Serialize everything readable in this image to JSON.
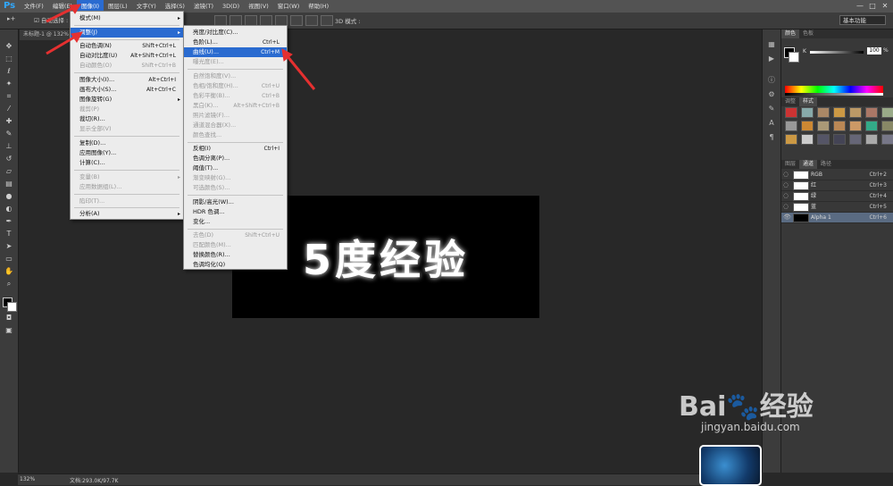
{
  "app": {
    "logo": "Ps",
    "accent_color": "#2a6bd0"
  },
  "menubar": {
    "items": [
      {
        "label": "文件(F)"
      },
      {
        "label": "编辑(E)"
      },
      {
        "label": "图像(I)",
        "active": true
      },
      {
        "label": "图层(L)"
      },
      {
        "label": "文字(Y)"
      },
      {
        "label": "选择(S)"
      },
      {
        "label": "滤镜(T)"
      },
      {
        "label": "3D(D)"
      },
      {
        "label": "视图(V)"
      },
      {
        "label": "窗口(W)"
      },
      {
        "label": "帮助(H)"
      }
    ],
    "window_controls": [
      "—",
      "□",
      "✕"
    ]
  },
  "options": {
    "tool_preset": "▸+",
    "auto_select": "☑ 自动选择 :",
    "mode_3d": "3D 模式 :",
    "workspace": "基本功能"
  },
  "doc_tab": {
    "label": "未标题-1 @ 132%"
  },
  "canvas": {
    "text": "5度经验",
    "background": "#000000"
  },
  "image_menu": {
    "items": [
      {
        "label": "模式(M)",
        "arrow": "▸"
      },
      {
        "label": "调整(J)",
        "arrow": "▸",
        "highlight": true
      },
      {
        "label": "自动色调(N)",
        "shortcut": "Shift+Ctrl+L"
      },
      {
        "label": "自动对比度(U)",
        "shortcut": "Alt+Shift+Ctrl+L"
      },
      {
        "label": "自动颜色(O)",
        "shortcut": "Shift+Ctrl+B",
        "disabled": true
      },
      {
        "label": "图像大小(I)...",
        "shortcut": "Alt+Ctrl+I"
      },
      {
        "label": "画布大小(S)...",
        "shortcut": "Alt+Ctrl+C"
      },
      {
        "label": "图像旋转(G)",
        "arrow": "▸"
      },
      {
        "label": "裁剪(P)",
        "disabled": true
      },
      {
        "label": "裁切(R)..."
      },
      {
        "label": "显示全部(V)",
        "disabled": true
      },
      {
        "label": "复制(D)..."
      },
      {
        "label": "应用图像(Y)..."
      },
      {
        "label": "计算(C)..."
      },
      {
        "label": "变量(B)",
        "arrow": "▸",
        "disabled": true
      },
      {
        "label": "应用数据组(L)...",
        "disabled": true
      },
      {
        "label": "陷印(T)...",
        "disabled": true
      },
      {
        "label": "分析(A)",
        "arrow": "▸"
      }
    ]
  },
  "adjust_menu": {
    "items": [
      {
        "label": "亮度/对比度(C)..."
      },
      {
        "label": "色阶(L)...",
        "shortcut": "Ctrl+L"
      },
      {
        "label": "曲线(U)...",
        "shortcut": "Ctrl+M",
        "highlight": true
      },
      {
        "label": "曝光度(E)...",
        "disabled": true
      },
      {
        "label": "自然饱和度(V)...",
        "disabled": true
      },
      {
        "label": "色相/饱和度(H)...",
        "shortcut": "Ctrl+U",
        "disabled": true
      },
      {
        "label": "色彩平衡(B)...",
        "shortcut": "Ctrl+B",
        "disabled": true
      },
      {
        "label": "黑白(K)...",
        "shortcut": "Alt+Shift+Ctrl+B",
        "disabled": true
      },
      {
        "label": "照片滤镜(F)...",
        "disabled": true
      },
      {
        "label": "通道混合器(X)...",
        "disabled": true
      },
      {
        "label": "颜色查找...",
        "disabled": true
      },
      {
        "label": "反相(I)",
        "shortcut": "Ctrl+I"
      },
      {
        "label": "色调分离(P)..."
      },
      {
        "label": "阈值(T)..."
      },
      {
        "label": "渐变映射(G)...",
        "disabled": true
      },
      {
        "label": "可选颜色(S)...",
        "disabled": true
      },
      {
        "label": "阴影/高光(W)..."
      },
      {
        "label": "HDR 色调..."
      },
      {
        "label": "变化..."
      },
      {
        "label": "去色(D)",
        "shortcut": "Shift+Ctrl+U",
        "disabled": true
      },
      {
        "label": "匹配颜色(M)...",
        "disabled": true
      },
      {
        "label": "替换颜色(R)..."
      },
      {
        "label": "色调均化(Q)"
      }
    ]
  },
  "panels": {
    "color_tabs": [
      "颜色",
      "色板"
    ],
    "k_label": "K",
    "k_value": "100",
    "pct": "%",
    "style_tabs": [
      "调整",
      "样式"
    ],
    "style_swatches": [
      "#c33",
      "#8aa",
      "#a86",
      "#c94",
      "#b96",
      "#a76",
      "#9a8",
      "#999",
      "#c83",
      "#a97",
      "#b85",
      "#c96",
      "#3a8",
      "#886",
      "#c94",
      "#ccc",
      "#556",
      "#445",
      "#667",
      "#aaa",
      "#778"
    ],
    "channel_tabs": [
      "图层",
      "通道",
      "路径"
    ],
    "channels": [
      {
        "name": "RGB",
        "key": "Ctrl+2"
      },
      {
        "name": "红",
        "key": "Ctrl+3"
      },
      {
        "name": "绿",
        "key": "Ctrl+4"
      },
      {
        "name": "蓝",
        "key": "Ctrl+5"
      },
      {
        "name": "Alpha 1",
        "key": "Ctrl+6",
        "selected": true
      }
    ]
  },
  "status": {
    "zoom": "132%",
    "doc": "文档:293.0K/97.7K"
  },
  "watermark": {
    "logo": "Bai🐾经验",
    "url": "jingyan.baidu.com"
  }
}
